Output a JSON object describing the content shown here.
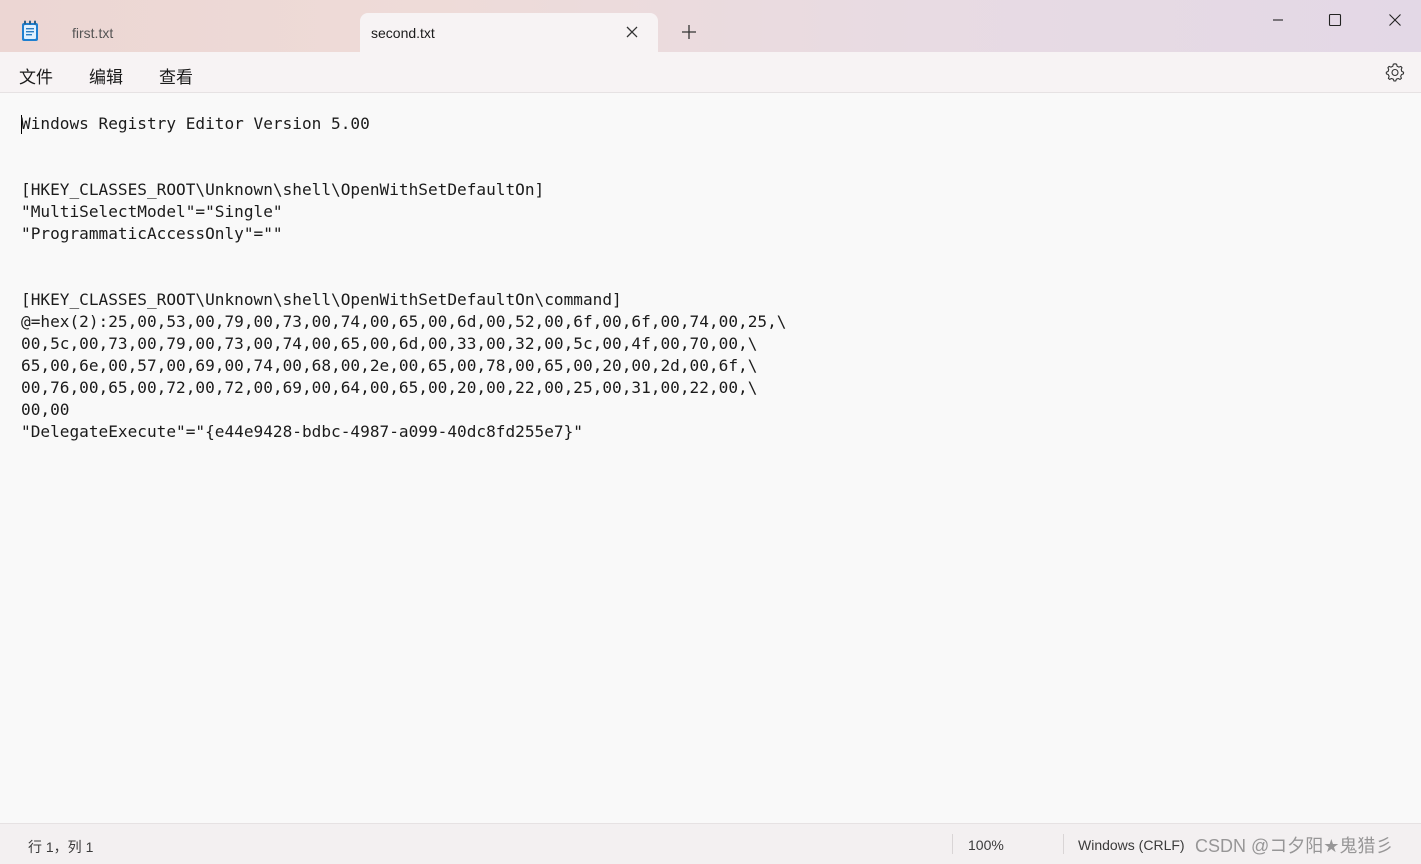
{
  "tabs": [
    {
      "label": "first.txt",
      "active": false
    },
    {
      "label": "second.txt",
      "active": true
    }
  ],
  "menu": [
    "文件",
    "编辑",
    "查看"
  ],
  "editor": {
    "content": "Windows Registry Editor Version 5.00\n\n\n[HKEY_CLASSES_ROOT\\Unknown\\shell\\OpenWithSetDefaultOn]\n\"MultiSelectModel\"=\"Single\"\n\"ProgrammaticAccessOnly\"=\"\"\n\n\n[HKEY_CLASSES_ROOT\\Unknown\\shell\\OpenWithSetDefaultOn\\command]\n@=hex(2):25,00,53,00,79,00,73,00,74,00,65,00,6d,00,52,00,6f,00,6f,00,74,00,25,\\\n00,5c,00,73,00,79,00,73,00,74,00,65,00,6d,00,33,00,32,00,5c,00,4f,00,70,00,\\\n65,00,6e,00,57,00,69,00,74,00,68,00,2e,00,65,00,78,00,65,00,20,00,2d,00,6f,\\\n00,76,00,65,00,72,00,72,00,69,00,64,00,65,00,20,00,22,00,25,00,31,00,22,00,\\\n00,00\n\"DelegateExecute\"=\"{e44e9428-bdbc-4987-a099-40dc8fd255e7}\""
  },
  "status": {
    "position": "行 1，列 1",
    "zoom": "100%",
    "line_ending": "Windows (CRLF)"
  },
  "watermark": "CSDN @コ夕阳★鬼猎彡",
  "icons": {
    "app": "notepad-icon",
    "close_tab": "close-icon",
    "new_tab": "plus-icon",
    "minimize": "minimize-icon",
    "maximize": "maximize-icon",
    "close_window": "close-icon",
    "settings": "gear-icon"
  }
}
